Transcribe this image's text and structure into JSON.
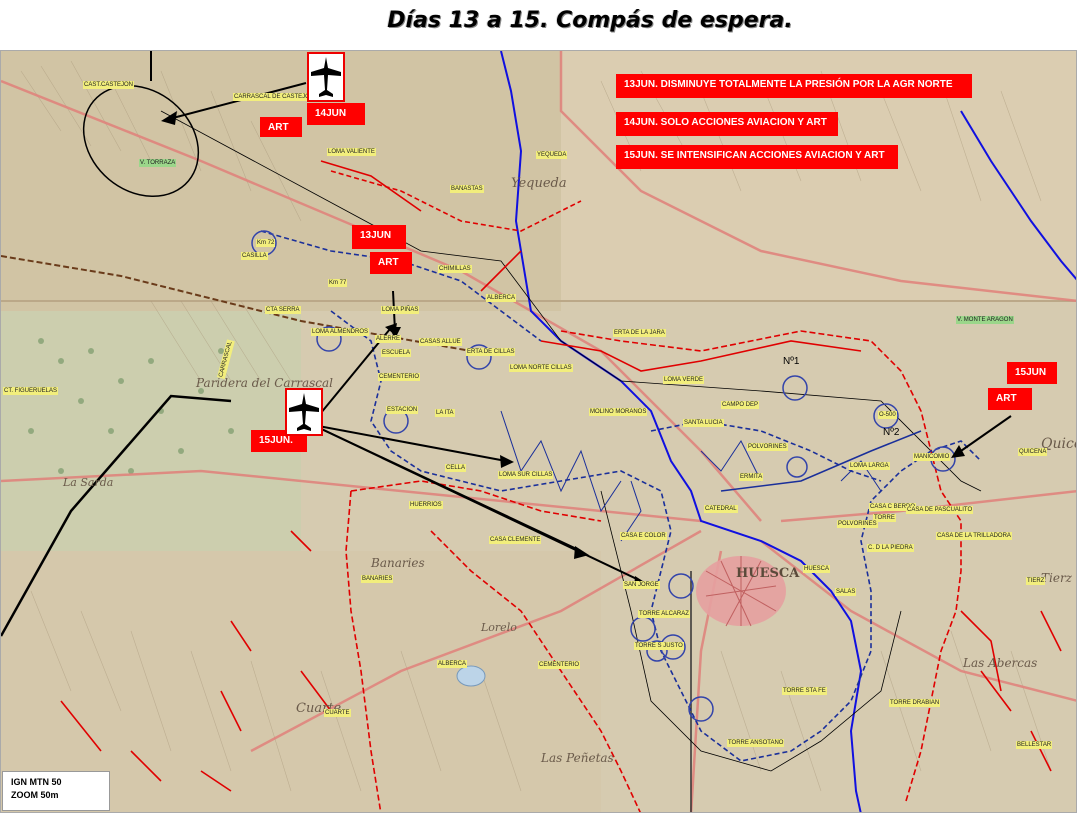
{
  "title": "Días 13 a 15. Compás de espera.",
  "notes": [
    "13JUN. DISMINUYE TOTALMENTE LA PRESIÓN POR LA AGR NORTE",
    "14JUN. SOLO ACCIONES AVIACION Y ART",
    "15JUN. SE INTENSIFICAN  ACCIONES AVIACION Y ART"
  ],
  "tags": {
    "d14": "14JUN",
    "art14": "ART",
    "d13": "13JUN",
    "art13": "ART",
    "d15w": "15JUN.",
    "d15e": "15JUN",
    "art15": "ART"
  },
  "sectors": {
    "n1": "Nº1",
    "n2": "Nº2"
  },
  "source": {
    "line1": "IGN MTN 50",
    "line2": "ZOOM 50m"
  },
  "place_labels": [
    "CAST.CASTEJON",
    "CARRASCAL DE CASTEJON",
    "V. TORRAZA",
    "LOMA VALIENTE",
    "YEQUEDA",
    "BANASTAS",
    "Km 72",
    "CASILLA",
    "Km 77",
    "CHIMILLAS",
    "ALBERCA",
    "CTA SERRA",
    "LOMA PIÑAS",
    "LOMA ALMENDROS",
    "ALERRE",
    "ESCUELA",
    "CASAS ALLUE",
    "ERTA DE CILLAS",
    "LOMA NORTE CILLAS",
    "CEMENTERIO",
    "ESTACION",
    "LA ITA",
    "ERTA DE LA JARA",
    "MOLINO MORANOS",
    "LOMA VERDE",
    "SANTA LUCIA",
    "CAMPO DEP",
    "POLVORINES",
    "ERMITA",
    "O-500",
    "LOMA LARGA",
    "MANICOMIO",
    "QUICENA",
    "V. MONTE ARAGON",
    "CASA C BERDO",
    "TORRE",
    "CASA DE PASCUALITO",
    "POLVORINES",
    "CASA DE LA TRILLADORA",
    "C. D LA PIEDRA",
    "HUESCA",
    "SALAS",
    "TIERZ",
    "CATEDRAL",
    "CASA E COLOR",
    "SAN JORGE",
    "TORRE ALCARAZ",
    "TORRE S JUSTO",
    "TORRE STA FE",
    "TORRE DRABIAN",
    "TORRE ANSOTANO",
    "BELLESTAR",
    "HUERRIOS",
    "CASA CLEMENTE",
    "BANARIES",
    "ALBERCA",
    "CEMENTERIO",
    "CUARTE",
    "CT. FIGUERUELAS",
    "CARRASCAL",
    "LOMA SUR CILLAS",
    "CELLA"
  ],
  "map_text": {
    "sarda": "La Sarda",
    "huesca": "HUESCA",
    "quicena": "Quice",
    "yequeda": "Yequeda",
    "carrascal": "Paridera del Carrascal",
    "banaries": "Banaries",
    "cuarte": "Cuarte",
    "penetas": "Las Peñetas",
    "abercas": "Las Abercas",
    "tierz": "Tierz",
    "lorelo": "Lorelo"
  },
  "colors": {
    "front_red": "#e00000",
    "front_blue": "#1a2f9a",
    "river": "#1010e0",
    "road": "#e0807a",
    "tag_bg": "#ff0000",
    "label_bg": "#f2ee7c"
  }
}
